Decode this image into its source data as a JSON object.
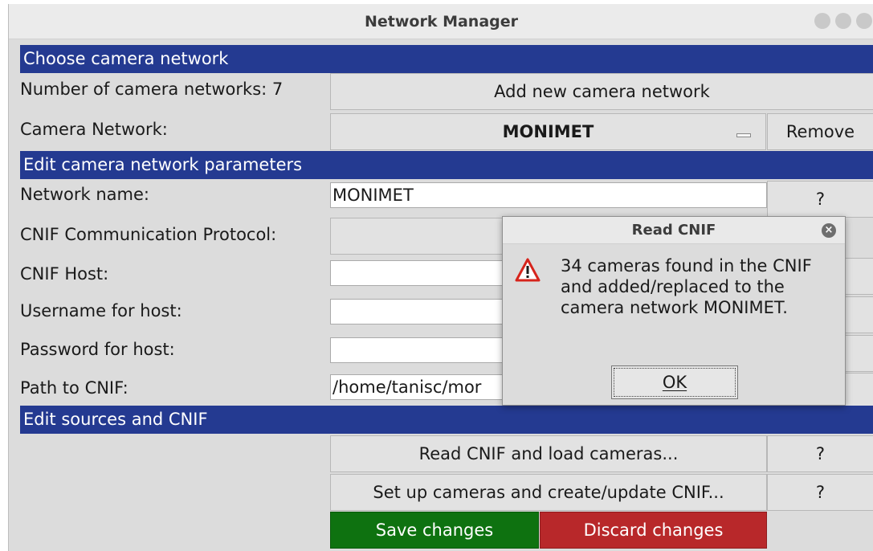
{
  "window": {
    "title": "Network Manager"
  },
  "sections": {
    "choose": "Choose camera network",
    "edit_params": "Edit camera network parameters",
    "edit_sources": "Edit sources and CNIF"
  },
  "choose": {
    "count_label": "Number of camera networks: 7",
    "add_button": "Add new camera network",
    "network_label": "Camera Network:",
    "network_value": "MONIMET",
    "remove_button": "Remove"
  },
  "params": {
    "name_label": "Network name:",
    "name_value": "MONIMET",
    "protocol_label": "CNIF Communication Protocol:",
    "host_label": "CNIF Host:",
    "username_label": "Username for host:",
    "password_label": "Password for host:",
    "path_label": "Path to CNIF:",
    "path_value": "/home/tanisc/mor",
    "help_glyph": "?"
  },
  "sources": {
    "read_button": "Read CNIF and load cameras...",
    "setup_button": "Set up cameras and create/update CNIF...",
    "help_glyph": "?"
  },
  "actions": {
    "save": "Save changes",
    "discard": "Discard changes",
    "save_color": "#0e7210",
    "discard_color": "#b8282a"
  },
  "dialog": {
    "title": "Read CNIF",
    "message": "34 cameras found in the CNIF and added/replaced to the camera network MONIMET.",
    "ok_button": "OK",
    "icon": "warning-icon",
    "warning_color": "#d6241c"
  }
}
